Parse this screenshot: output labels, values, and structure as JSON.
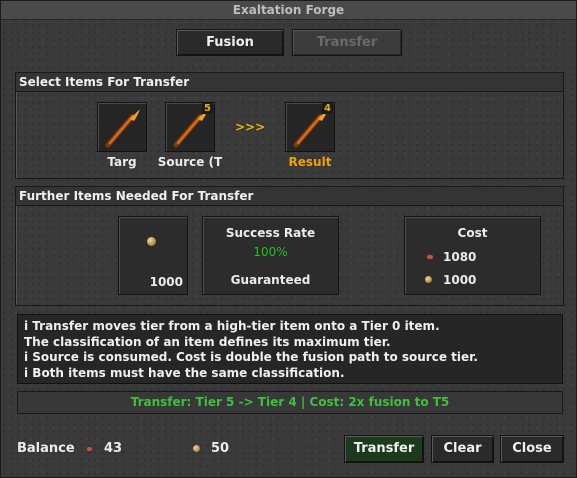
{
  "window": {
    "title": "Exaltation Forge"
  },
  "tabs": [
    {
      "label": "Fusion",
      "enabled": true
    },
    {
      "label": "Transfer",
      "enabled": false
    }
  ],
  "select_panel": {
    "title": "Select Items For Transfer",
    "target": {
      "label": "Targ",
      "icon": "staff-icon"
    },
    "source": {
      "label": "Source (T",
      "tier": "5",
      "icon": "staff-icon"
    },
    "arrow": ">>>",
    "result": {
      "label": "Result",
      "tier": "4",
      "icon": "staff-icon"
    }
  },
  "further_panel": {
    "title": "Further Items Needed For Transfer",
    "item": {
      "count": "1000",
      "icon": "gold-coin-icon"
    },
    "success": {
      "label": "Success Rate",
      "value": "100%",
      "note": "Guaranteed"
    },
    "cost": {
      "label": "Cost",
      "lines": [
        {
          "icon": "red-gem-icon",
          "value": "1080"
        },
        {
          "icon": "gold-coin-icon",
          "value": "1000"
        }
      ]
    }
  },
  "info_lines": [
    "i  Transfer moves tier from a high-tier item onto a Tier 0 item.",
    "The classification of an item defines its maximum tier.",
    "i  Source is consumed. Cost is double the fusion path to source tier.",
    "i  Both items must have the same classification."
  ],
  "status": "Transfer: Tier 5 -> Tier 4 | Cost: 2x fusion to T5",
  "footer": {
    "balance_label": "Balance",
    "balance_gems": "43",
    "balance_coins": "50",
    "transfer_label": "Transfer",
    "clear_label": "Clear",
    "close_label": "Close"
  },
  "colors": {
    "accent_green": "#3ec03e",
    "tier_gold": "#e8b400",
    "result_orange": "#f0a000",
    "success_green": "#22c022"
  }
}
